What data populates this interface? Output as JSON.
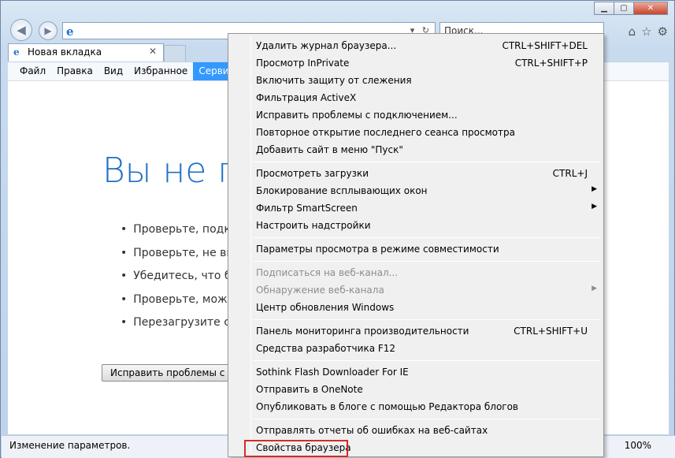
{
  "toolbar": {
    "search_placeholder": "Поиск...",
    "tab_title": "Новая вкладка"
  },
  "menubar": [
    "Файл",
    "Правка",
    "Вид",
    "Избранное",
    "Сервис"
  ],
  "page": {
    "headline": "Вы не п",
    "bullets": [
      "Проверьте, подкл",
      "Проверьте, не вкл",
      "Убедитесь, что бе",
      "Проверьте, може",
      "Перезагрузите св"
    ],
    "fix_button": "Исправить проблемы с под"
  },
  "status": {
    "text": "Изменение параметров.",
    "zoom": "100%"
  },
  "menu": [
    {
      "label": "Удалить журнал браузера...",
      "shortcut": "CTRL+SHIFT+DEL"
    },
    {
      "label": "Просмотр InPrivate",
      "shortcut": "CTRL+SHIFT+P"
    },
    {
      "label": "Включить защиту от слежения",
      "shortcut": ""
    },
    {
      "label": "Фильтрация ActiveX",
      "shortcut": ""
    },
    {
      "label": "Исправить проблемы с подключением...",
      "shortcut": ""
    },
    {
      "label": "Повторное открытие последнего сеанса просмотра",
      "shortcut": ""
    },
    {
      "label": "Добавить сайт в меню \"Пуск\"",
      "shortcut": ""
    },
    {
      "label": "Просмотреть загрузки",
      "shortcut": "CTRL+J"
    },
    {
      "label": "Блокирование всплывающих окон",
      "shortcut": ""
    },
    {
      "label": "Фильтр SmartScreen",
      "shortcut": ""
    },
    {
      "label": "Настроить надстройки",
      "shortcut": ""
    },
    {
      "label": "Параметры просмотра в режиме совместимости",
      "shortcut": ""
    },
    {
      "label": "Подписаться на веб-канал...",
      "shortcut": ""
    },
    {
      "label": "Обнаружение веб-канала",
      "shortcut": ""
    },
    {
      "label": "Центр обновления Windows",
      "shortcut": ""
    },
    {
      "label": "Панель мониторинга производительности",
      "shortcut": "CTRL+SHIFT+U"
    },
    {
      "label": "Средства разработчика F12",
      "shortcut": ""
    },
    {
      "label": "Sothink Flash Downloader For IE",
      "shortcut": ""
    },
    {
      "label": "Отправить в OneNote",
      "shortcut": ""
    },
    {
      "label": "Опубликовать в блоге с помощью Редактора блогов",
      "shortcut": ""
    },
    {
      "label": "Отправлять отчеты об ошибках на веб-сайтах",
      "shortcut": ""
    },
    {
      "label": "Свойства браузера",
      "shortcut": ""
    }
  ]
}
